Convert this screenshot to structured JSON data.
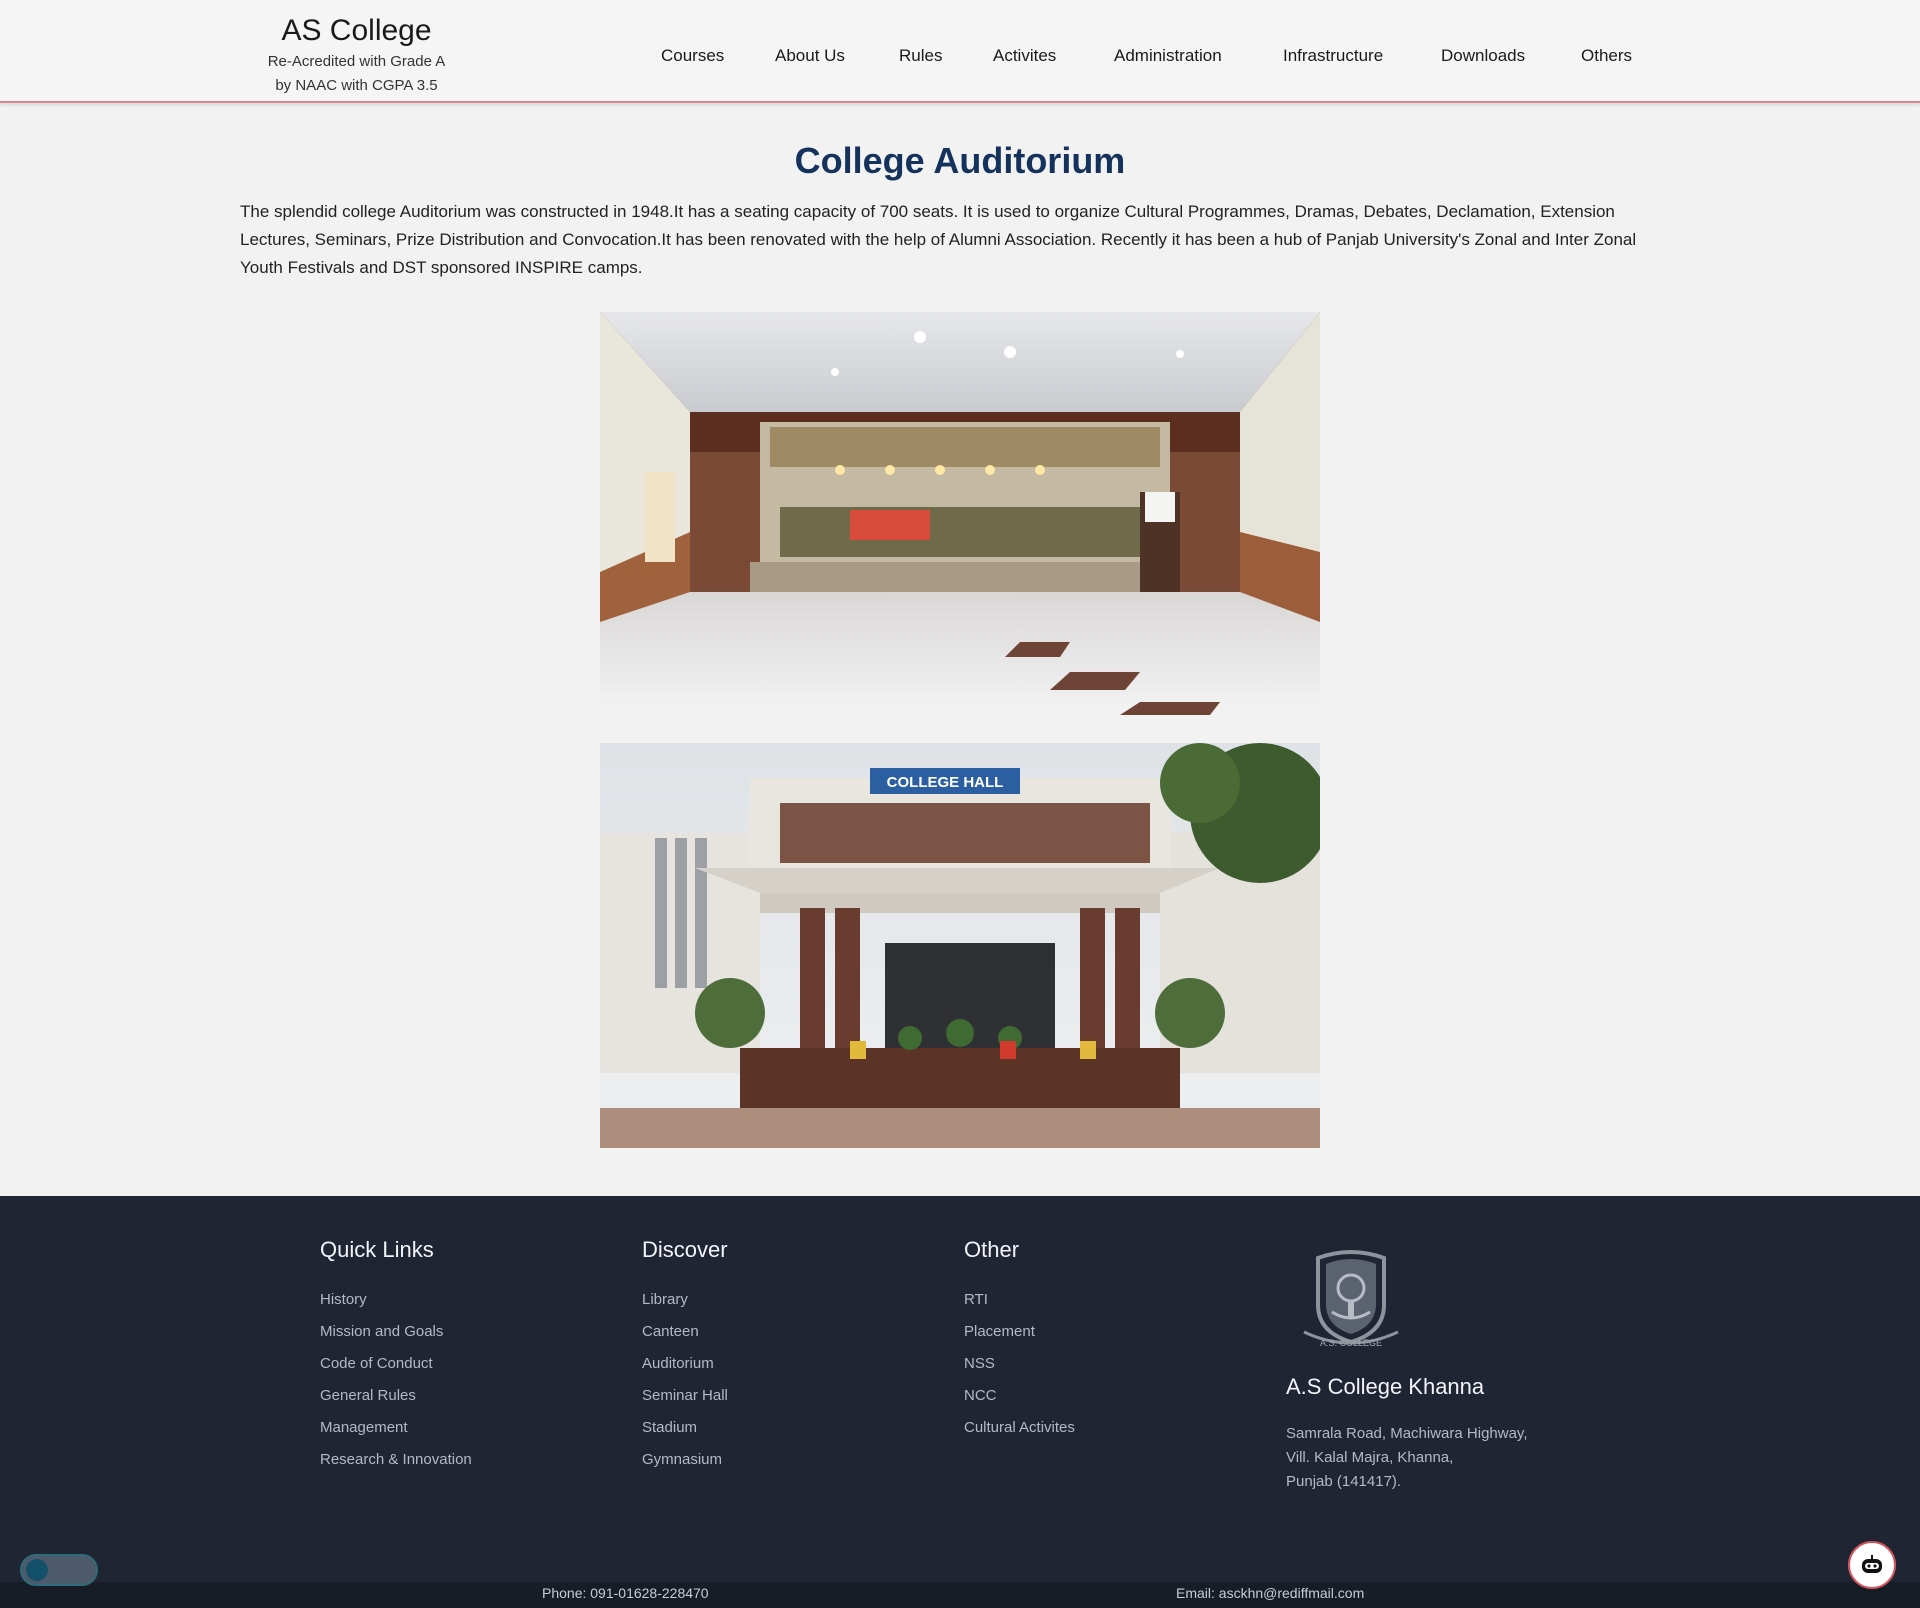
{
  "header": {
    "brand_title": "AS College",
    "brand_sub_1": "Re-Acredited with Grade A",
    "brand_sub_2": "by NAAC with CGPA 3.5",
    "nav": [
      "Courses",
      "About Us",
      "Rules",
      "Activites",
      "Administration",
      "Infrastructure",
      "Downloads",
      "Others"
    ]
  },
  "main": {
    "title": "College Auditorium",
    "intro": "The splendid college Auditorium was constructed in 1948.It has a seating capacity of 700 seats. It is used to organize Cultural Programmes, Dramas, Debates, Declamation, Extension Lectures, Seminars, Prize Distribution and Convocation.It has been renovated with the help of Alumni Association. Recently it has been a hub of Panjab University's Zonal and Inter Zonal Youth Festivals and DST sponsored INSPIRE camps.",
    "photo_2_sign": "COLLEGE HALL"
  },
  "footer": {
    "quick_links": {
      "heading": "Quick Links",
      "items": [
        "History",
        "Mission and Goals",
        "Code of Conduct",
        "General Rules",
        "Management",
        "Research & Innovation"
      ]
    },
    "discover": {
      "heading": "Discover",
      "items": [
        "Library",
        "Canteen",
        "Auditorium",
        "Seminar Hall",
        "Stadium",
        "Gymnasium"
      ]
    },
    "other": {
      "heading": "Other",
      "items": [
        "RTI",
        "Placement",
        "NSS",
        "NCC",
        "Cultural Activites"
      ]
    },
    "logo_text": "A.S. COLLEGE",
    "org_name": "A.S College Khanna",
    "address": [
      "Samrala Road, Machiwara Highway,",
      "Vill. Kalal Majra, Khanna,",
      "Punjab (141417)."
    ],
    "phone": "Phone: 091-01628-228470",
    "email": "Email: asckhn@rediffmail.com"
  },
  "colors": {
    "header_border": "#d9868f",
    "title": "#14325c",
    "footer_bg": "#1f2533"
  }
}
